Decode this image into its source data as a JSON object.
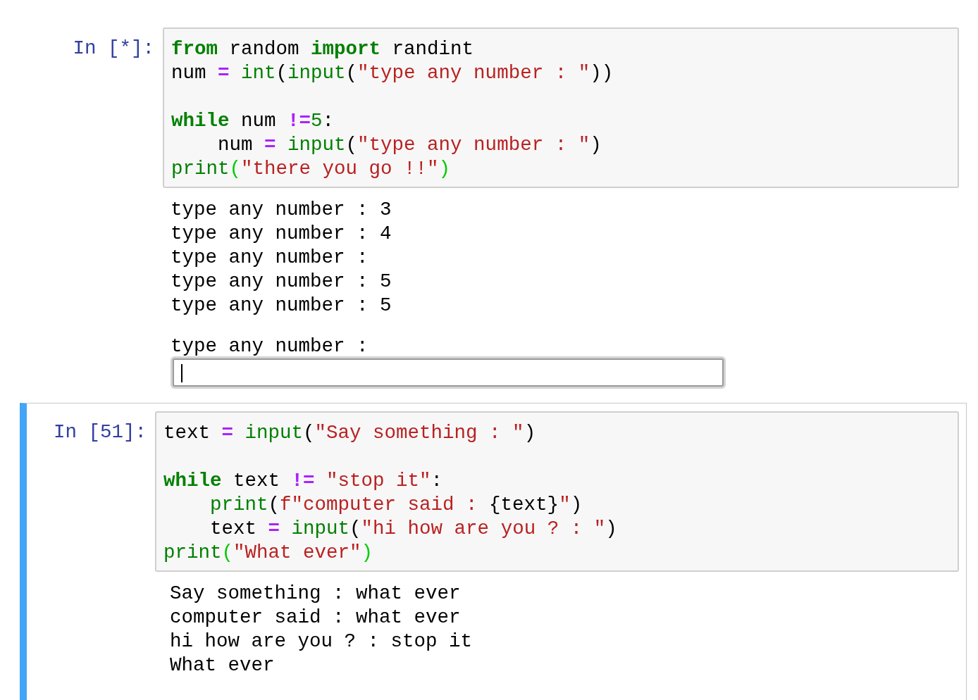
{
  "cells": [
    {
      "prompt": "In [*]:",
      "selected": false,
      "code": [
        {
          "kind": "code",
          "tokens": [
            {
              "kind": "kw",
              "text": "from"
            },
            {
              "kind": "plain",
              "text": " random "
            },
            {
              "kind": "kw",
              "text": "import"
            },
            {
              "kind": "plain",
              "text": " randint"
            }
          ]
        },
        {
          "kind": "code",
          "tokens": [
            {
              "kind": "plain",
              "text": "num "
            },
            {
              "kind": "op",
              "text": "="
            },
            {
              "kind": "builtin",
              "text": " int"
            },
            {
              "kind": "plain",
              "text": "("
            },
            {
              "kind": "builtin",
              "text": "input"
            },
            {
              "kind": "plain",
              "text": "("
            },
            {
              "kind": "str",
              "text": "\"type any number : \""
            },
            {
              "kind": "plain",
              "text": "))"
            }
          ]
        },
        {
          "kind": "blank"
        },
        {
          "kind": "code",
          "tokens": [
            {
              "kind": "kw",
              "text": "while"
            },
            {
              "kind": "plain",
              "text": " num "
            },
            {
              "kind": "op",
              "text": "!="
            },
            {
              "kind": "num",
              "text": "5"
            },
            {
              "kind": "plain",
              "text": ":"
            }
          ]
        },
        {
          "kind": "code",
          "tokens": [
            {
              "kind": "plain",
              "text": "    num "
            },
            {
              "kind": "op",
              "text": "="
            },
            {
              "kind": "builtin",
              "text": " input"
            },
            {
              "kind": "plain",
              "text": "("
            },
            {
              "kind": "str",
              "text": "\"type any number : \""
            },
            {
              "kind": "plain",
              "text": ")"
            }
          ]
        },
        {
          "kind": "code",
          "tokens": [
            {
              "kind": "builtin",
              "text": "print"
            },
            {
              "kind": "match",
              "text": "("
            },
            {
              "kind": "str",
              "text": "\"there you go !!\""
            },
            {
              "kind": "match",
              "text": ")"
            }
          ]
        }
      ],
      "output": [
        {
          "kind": "text",
          "lines": [
            "type any number : 3",
            "type any number : 4",
            "type any number :",
            "type any number : 5",
            "type any number : 5"
          ]
        },
        {
          "kind": "stdin",
          "prompt": "type any number :",
          "focused": true
        }
      ]
    },
    {
      "prompt": "In [51]:",
      "selected": true,
      "code": [
        {
          "kind": "code",
          "tokens": [
            {
              "kind": "plain",
              "text": "text "
            },
            {
              "kind": "op",
              "text": "="
            },
            {
              "kind": "builtin",
              "text": " input"
            },
            {
              "kind": "plain",
              "text": "("
            },
            {
              "kind": "str",
              "text": "\"Say something : \""
            },
            {
              "kind": "plain",
              "text": ")"
            }
          ]
        },
        {
          "kind": "blank"
        },
        {
          "kind": "code",
          "tokens": [
            {
              "kind": "kw",
              "text": "while"
            },
            {
              "kind": "plain",
              "text": " text "
            },
            {
              "kind": "op",
              "text": "!="
            },
            {
              "kind": "str",
              "text": " \"stop it\""
            },
            {
              "kind": "plain",
              "text": ":"
            }
          ]
        },
        {
          "kind": "code",
          "tokens": [
            {
              "kind": "builtin",
              "text": "    print"
            },
            {
              "kind": "plain",
              "text": "("
            },
            {
              "kind": "str",
              "text": "f\"computer said : "
            },
            {
              "kind": "plain",
              "text": "{text}"
            },
            {
              "kind": "str",
              "text": "\""
            },
            {
              "kind": "plain",
              "text": ")"
            }
          ]
        },
        {
          "kind": "code",
          "tokens": [
            {
              "kind": "plain",
              "text": "    text "
            },
            {
              "kind": "op",
              "text": "="
            },
            {
              "kind": "builtin",
              "text": " input"
            },
            {
              "kind": "plain",
              "text": "("
            },
            {
              "kind": "str",
              "text": "\"hi how are you ? : \""
            },
            {
              "kind": "plain",
              "text": ")"
            }
          ]
        },
        {
          "kind": "code",
          "tokens": [
            {
              "kind": "builtin",
              "text": "print"
            },
            {
              "kind": "match",
              "text": "("
            },
            {
              "kind": "str",
              "text": "\"What ever\""
            },
            {
              "kind": "match",
              "text": ")"
            }
          ]
        }
      ],
      "output": [
        {
          "kind": "text",
          "lines": [
            "Say something : what ever",
            "computer said : what ever",
            "hi how are you ? : stop it",
            "What ever"
          ]
        }
      ]
    }
  ]
}
